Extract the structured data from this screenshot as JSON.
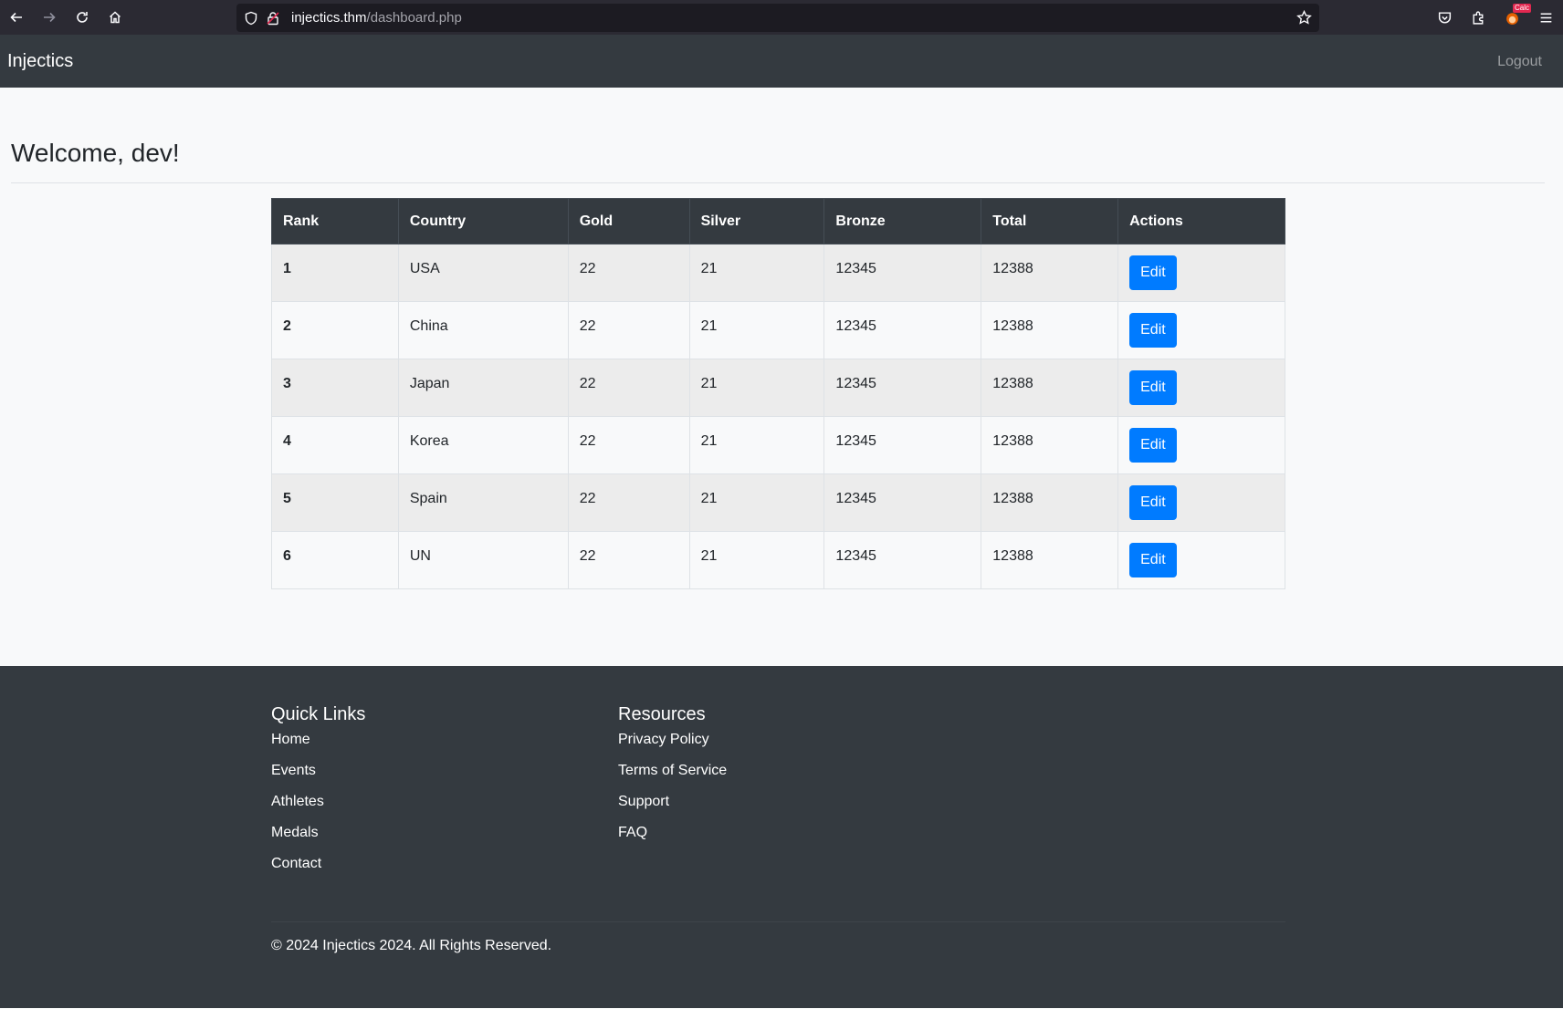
{
  "browser": {
    "url_host": "injectics.thm",
    "url_path": "/dashboard.php",
    "extension_badge": "Calc"
  },
  "navbar": {
    "brand": "Injectics",
    "logout": "Logout"
  },
  "main": {
    "welcome": "Welcome, dev!"
  },
  "table": {
    "headers": [
      "Rank",
      "Country",
      "Gold",
      "Silver",
      "Bronze",
      "Total",
      "Actions"
    ],
    "rows": [
      {
        "rank": "1",
        "country": "USA",
        "gold": "22",
        "silver": "21",
        "bronze": "12345",
        "total": "12388",
        "action": "Edit"
      },
      {
        "rank": "2",
        "country": "China",
        "gold": "22",
        "silver": "21",
        "bronze": "12345",
        "total": "12388",
        "action": "Edit"
      },
      {
        "rank": "3",
        "country": "Japan",
        "gold": "22",
        "silver": "21",
        "bronze": "12345",
        "total": "12388",
        "action": "Edit"
      },
      {
        "rank": "4",
        "country": "Korea",
        "gold": "22",
        "silver": "21",
        "bronze": "12345",
        "total": "12388",
        "action": "Edit"
      },
      {
        "rank": "5",
        "country": "Spain",
        "gold": "22",
        "silver": "21",
        "bronze": "12345",
        "total": "12388",
        "action": "Edit"
      },
      {
        "rank": "6",
        "country": "UN",
        "gold": "22",
        "silver": "21",
        "bronze": "12345",
        "total": "12388",
        "action": "Edit"
      }
    ]
  },
  "footer": {
    "quick_links": {
      "title": "Quick Links",
      "items": [
        "Home",
        "Events",
        "Athletes",
        "Medals",
        "Contact"
      ]
    },
    "resources": {
      "title": "Resources",
      "items": [
        "Privacy Policy",
        "Terms of Service",
        "Support",
        "FAQ"
      ]
    },
    "copyright": "© 2024 Injectics 2024. All Rights Reserved."
  },
  "colors": {
    "navbar_bg": "#343a40",
    "button_primary": "#007bff",
    "page_bg": "#f8f9fa"
  }
}
